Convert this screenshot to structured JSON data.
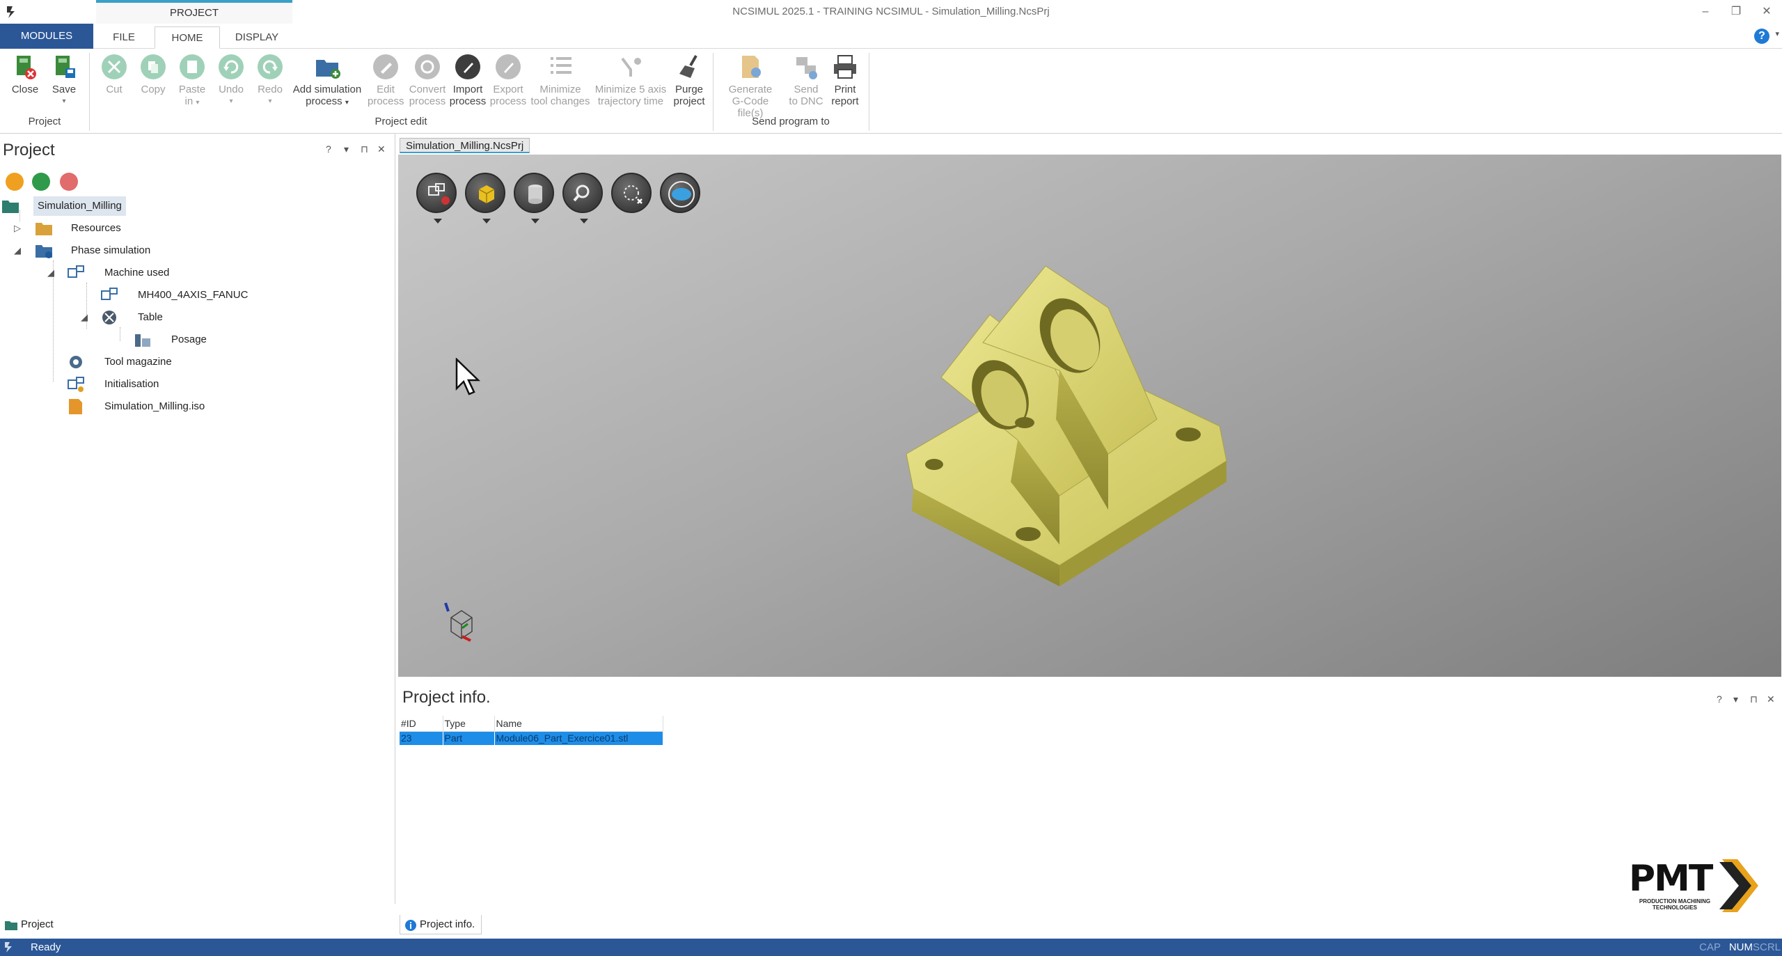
{
  "window": {
    "title": "NCSIMUL 2025.1 - TRAINING NCSIMUL - Simulation_Milling.NcsPrj",
    "context_tab": "PROJECT"
  },
  "tabs": {
    "modules": "MODULES",
    "file": "FILE",
    "home": "HOME",
    "display": "DISPLAY"
  },
  "ribbon": {
    "groups": {
      "project": "Project",
      "project_edit": "Project edit",
      "send_program": "Send program to"
    },
    "buttons": {
      "close": "Close",
      "save": "Save",
      "cut": "Cut",
      "copy": "Copy",
      "paste_1": "Paste",
      "paste_2": "in",
      "undo": "Undo",
      "redo": "Redo",
      "add_sim_1": "Add simulation",
      "add_sim_2": "process",
      "edit_1": "Edit",
      "edit_2": "process",
      "convert_1": "Convert",
      "convert_2": "process",
      "import_1": "Import",
      "import_2": "process",
      "export_1": "Export",
      "export_2": "process",
      "minimize_1": "Minimize",
      "minimize_2": "tool changes",
      "min5_1": "Minimize 5 axis",
      "min5_2": "trajectory time",
      "purge_1": "Purge",
      "purge_2": "project",
      "gen_1": "Generate",
      "gen_2": "G-Code file(s)",
      "send_1": "Send",
      "send_2": "to DNC",
      "print_1": "Print",
      "print_2": "report"
    }
  },
  "left_panel": {
    "title": "Project",
    "tree": {
      "root": "Simulation_Milling",
      "resources": "Resources",
      "phase": "Phase simulation",
      "machine_used": "Machine used",
      "machine": "MH400_4AXIS_FANUC",
      "table": "Table",
      "posage": "Posage",
      "tool_magazine": "Tool magazine",
      "initialisation": "Initialisation",
      "iso": "Simulation_Milling.iso"
    }
  },
  "document": {
    "tab": "Simulation_Milling.NcsPrj"
  },
  "info_panel": {
    "title": "Project info.",
    "columns": [
      "#ID",
      "Type",
      "Name"
    ],
    "rows": [
      {
        "id": "23",
        "type": "Part",
        "name": "Module06_Part_Exercice01.stl"
      }
    ]
  },
  "bottom_tabs": {
    "project": "Project",
    "info": "Project info."
  },
  "status": {
    "text": "Ready",
    "cap": "CAP",
    "num": "NUM",
    "scrl": "SCRL"
  },
  "logo": {
    "name": "PMT",
    "tagline_1": "PRODUCTION MACHINING",
    "tagline_2": "TECHNOLOGIES"
  },
  "colors": {
    "accent": "#2b5797",
    "selection": "#1e8de8",
    "part": "#d8d26a"
  }
}
